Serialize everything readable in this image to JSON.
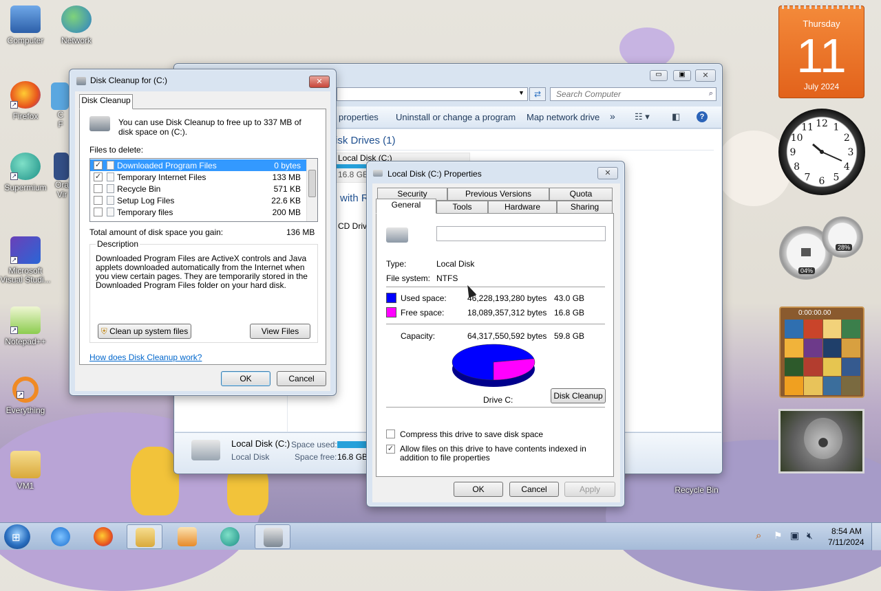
{
  "desktop": {
    "icons": [
      {
        "label": "Computer"
      },
      {
        "label": "Network"
      },
      {
        "label": "Firefox"
      },
      {
        "label": "Supermium"
      },
      {
        "label": "Microsoft Visual Studi..."
      },
      {
        "label": "Notepad++"
      },
      {
        "label": "Everything"
      },
      {
        "label": "VM1"
      },
      {
        "label": "Recycle Bin"
      },
      {
        "label": "C"
      },
      {
        "label": "F"
      },
      {
        "label": "Ora"
      },
      {
        "label": "Vir"
      }
    ]
  },
  "calendar_gadget": {
    "weekday": "Thursday",
    "day": "11",
    "month_year": "July 2024"
  },
  "clock_gadget": {
    "numbers": [
      "12",
      "1",
      "2",
      "3",
      "4",
      "5",
      "6",
      "7",
      "8",
      "9",
      "10",
      "11"
    ]
  },
  "meter_gadget": {
    "cpu": "04%",
    "ram": "28%"
  },
  "puzzle_gadget": {
    "timer": "0:00:00.00"
  },
  "explorer": {
    "search_placeholder": "Search Computer",
    "toolbar": {
      "properties": "properties",
      "uninstall": "Uninstall or change a program",
      "map_drive": "Map network drive",
      "more": "»"
    },
    "section_hdd": "isk Drives (1)",
    "drive_name": "Local Disk (C:)",
    "drive_size": "16.8 GB",
    "section_removable": "with R",
    "cd_drive": "CD Drive",
    "details": {
      "name": "Local Disk (C:)",
      "type": "Local Disk",
      "used_label": "Space used:",
      "free_label": "Space free:",
      "free_value": "16.8 GB"
    }
  },
  "cleanup": {
    "title": "Disk Cleanup for  (C:)",
    "tab": "Disk Cleanup",
    "intro": "You can use Disk Cleanup to free up to 337 MB of disk space on  (C:).",
    "files_label": "Files to delete:",
    "files": [
      {
        "name": "Downloaded Program Files",
        "size": "0 bytes",
        "checked": true,
        "selected": true
      },
      {
        "name": "Temporary Internet Files",
        "size": "133 MB",
        "checked": true,
        "selected": false
      },
      {
        "name": "Recycle Bin",
        "size": "571 KB",
        "checked": false,
        "selected": false
      },
      {
        "name": "Setup Log Files",
        "size": "22.6 KB",
        "checked": false,
        "selected": false
      },
      {
        "name": "Temporary files",
        "size": "200 MB",
        "checked": false,
        "selected": false
      }
    ],
    "total_label": "Total amount of disk space you gain:",
    "total_value": "136 MB",
    "description_label": "Description",
    "description": "Downloaded Program Files are ActiveX controls and Java applets downloaded automatically from the Internet when you view certain pages. They are temporarily stored in the Downloaded Program Files folder on your hard disk.",
    "clean_system": "Clean up system files",
    "view_files": "View Files",
    "help_link": "How does Disk Cleanup work?",
    "ok": "OK",
    "cancel": "Cancel"
  },
  "props": {
    "title": "Local Disk (C:) Properties",
    "tabs_top": [
      "Security",
      "Previous Versions",
      "Quota"
    ],
    "tabs_bottom": [
      "General",
      "Tools",
      "Hardware",
      "Sharing"
    ],
    "name_value": "",
    "type_label": "Type:",
    "type_value": "Local Disk",
    "fs_label": "File system:",
    "fs_value": "NTFS",
    "used_label": "Used space:",
    "used_bytes": "46,228,193,280 bytes",
    "used_gb": "43.0 GB",
    "free_label": "Free space:",
    "free_bytes": "18,089,357,312 bytes",
    "free_gb": "16.8 GB",
    "cap_label": "Capacity:",
    "cap_bytes": "64,317,550,592 bytes",
    "cap_gb": "59.8 GB",
    "drive_label": "Drive C:",
    "disk_cleanup": "Disk Cleanup",
    "compress_label": "Compress this drive to save disk space",
    "compress_checked": false,
    "index_label": "Allow files on this drive to have contents indexed in addition to file properties",
    "index_checked": true,
    "ok": "OK",
    "cancel": "Cancel",
    "apply": "Apply",
    "used_color": "#0000ff",
    "free_color": "#ff00ff"
  },
  "chart_data": {
    "type": "pie",
    "categories": [
      "Used space",
      "Free space"
    ],
    "values": [
      43.0,
      16.8
    ],
    "colors": [
      "#0000ff",
      "#ff00ff"
    ]
  },
  "taskbar": {
    "items": [
      "start-orb",
      "internet-explorer",
      "firefox",
      "explorer",
      "media-player",
      "supermium",
      "disk-cleanup"
    ],
    "time": "8:54 AM",
    "date": "7/11/2024"
  }
}
